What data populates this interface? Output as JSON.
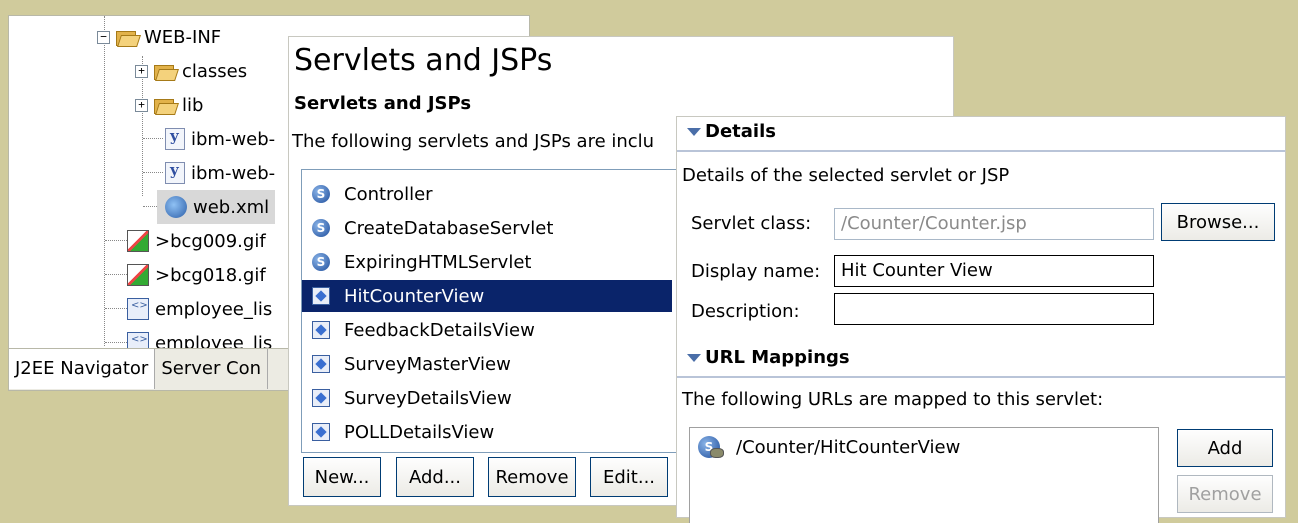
{
  "navigator": {
    "tree": [
      {
        "label": "WEB-INF",
        "type": "folder",
        "expander": "−"
      },
      {
        "label": "classes",
        "type": "folder",
        "expander": "+"
      },
      {
        "label": "lib",
        "type": "folder",
        "expander": "+"
      },
      {
        "label": "ibm-web-",
        "type": "xml"
      },
      {
        "label": "ibm-web-",
        "type": "xml"
      },
      {
        "label": "web.xml",
        "type": "webxml",
        "selected": true
      },
      {
        "label": ">bcg009.gif",
        "type": "gif"
      },
      {
        "label": ">bcg018.gif",
        "type": "gif"
      },
      {
        "label": "employee_lis",
        "type": "html"
      },
      {
        "label": "employee_lis",
        "type": "html"
      }
    ],
    "tabs": [
      "J2EE Navigator",
      "Server Con"
    ]
  },
  "servlets": {
    "title": "Servlets and JSPs",
    "section": "Servlets and JSPs",
    "description": "The following servlets and JSPs are inclu",
    "items": [
      {
        "label": "Controller",
        "kind": "servlet"
      },
      {
        "label": "CreateDatabaseServlet",
        "kind": "servlet"
      },
      {
        "label": "ExpiringHTMLServlet",
        "kind": "servlet"
      },
      {
        "label": "HitCounterView",
        "kind": "jsp",
        "selected": true
      },
      {
        "label": "FeedbackDetailsView",
        "kind": "jsp"
      },
      {
        "label": "SurveyMasterView",
        "kind": "jsp"
      },
      {
        "label": "SurveyDetailsView",
        "kind": "jsp"
      },
      {
        "label": "POLLDetailsView",
        "kind": "jsp"
      }
    ],
    "buttons": {
      "new": "New...",
      "add": "Add...",
      "remove": "Remove",
      "edit": "Edit..."
    },
    "servlet_icon_letter": "S"
  },
  "details": {
    "heading": "Details",
    "description": "Details of the selected servlet or JSP",
    "servlet_class_label": "Servlet class:",
    "servlet_class_value": "/Counter/Counter.jsp",
    "browse_label": "Browse...",
    "display_name_label": "Display name:",
    "display_name_value": "Hit Counter View",
    "description_label": "Description:",
    "description_value": ""
  },
  "url_mappings": {
    "heading": "URL Mappings",
    "description": "The following URLs are mapped to this servlet:",
    "items": [
      "/Counter/HitCounterView"
    ],
    "add_label": "Add",
    "remove_label": "Remove"
  },
  "colors": {
    "background": "#d0cb9c",
    "selection": "#0a246a",
    "section_line": "#b9c4d8"
  }
}
